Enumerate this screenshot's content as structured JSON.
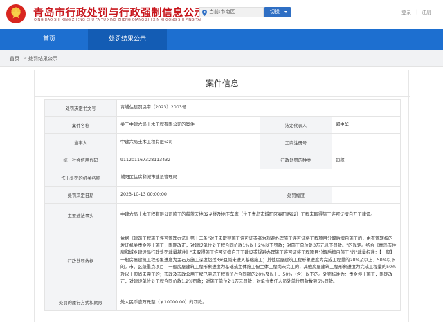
{
  "header": {
    "site_title": "青岛市行政处罚与行政强制信息公示平台",
    "site_subtitle": "QING DAO SHI XING ZHENG CHU FA YU XING ZHENG QIANG ZHI XIN XI GONG SHI PING TAI",
    "region_label": "当前:市南区",
    "switch_label": "切换",
    "login_label": "登录",
    "register_label": "注册",
    "separator": "|",
    "emblem_icon": "national-emblem-icon",
    "location_icon": "location-pin-icon"
  },
  "nav": {
    "items": [
      {
        "label": "首页"
      },
      {
        "label": "处罚结果公示"
      }
    ],
    "active_index": 1
  },
  "breadcrumb": {
    "home": "首页",
    "separator": ">",
    "current": "处罚结果公示"
  },
  "card": {
    "title": "案件信息"
  },
  "fields": {
    "decision_no_label": "处罚决定书文号",
    "decision_no": "青城住建罚决审〔2023〕2003号",
    "case_name_label": "案件名称",
    "case_name": "关于中建六局土木工程有限公司的案件",
    "legal_rep_label": "法定代表人",
    "legal_rep": "郭中华",
    "party_label": "当事人",
    "party": "中建六局土木工程有限公司",
    "business_reg_label": "工商注册号",
    "business_reg": "",
    "credit_code_label": "统一社会信用代码",
    "credit_code": "911201167328113432",
    "penalty_type_label": "行政处罚的种类",
    "penalty_type": "罚款",
    "authority_label": "作出处罚的机关名称",
    "authority": "城阳区住房和城市建设管理局",
    "decision_date_label": "处罚决定日期",
    "decision_date": "2023-10-13 00:00:00",
    "penalty_amount_label": "处罚幅度",
    "penalty_amount": "",
    "facts_label": "主要违法事实",
    "facts": "中建六局土木工程有限公司施工的鼓蓝天地32#楼及地下车库（位于青岛市城阳区春阳路92）工程未取得施工许可证擅自开工建设。",
    "basis_label": "行政处罚依据",
    "basis": "依据《建筑工程施工许可管理办法》第十二条\"对于未取得施工许可证或者为规避办理施工许可证将工程项目分解后擅自施工的，由有管辖权的发证机关责令停止施工，限期改正，对建设单位处工程合同价款1%以上2%以下罚款；对施工单位处3万元以下罚款。\"的规定。结合《青岛市住房和城乡建设局行政处罚裁量基准》\"未取得施工许可证擅自开工建设或规避办理施工许可证将工程项目分解后擅自施工\"的\"裁量标准：【一般】一般房屋建筑工程形象进度为主石方施工深度超过3米且尚未进入基础施工；其他房屋建筑工程形象进度为完成工程量的20%及以上、50%以下的。市、区级重点项目：一般房屋建筑工程形象进度为基础或主体施工但主体工程尚未完工的，其他房屋建筑工程形象进度为完成工程量的50%及以上但尚未完工的；市政及市政公用工程已完成工程造价占合同额的20%及以上、50%（含）以下的。处罚标准为：责令停止施工，限期改正，对建设单位处工程合同价款1.2%罚款；对施工单位处1万元罚款；对单位责任人员处单位罚款数额6%罚款。",
    "execution_label": "处罚的履行方式和期限",
    "execution": "处人民币壹万元整（￥10000.00）的罚款。"
  }
}
